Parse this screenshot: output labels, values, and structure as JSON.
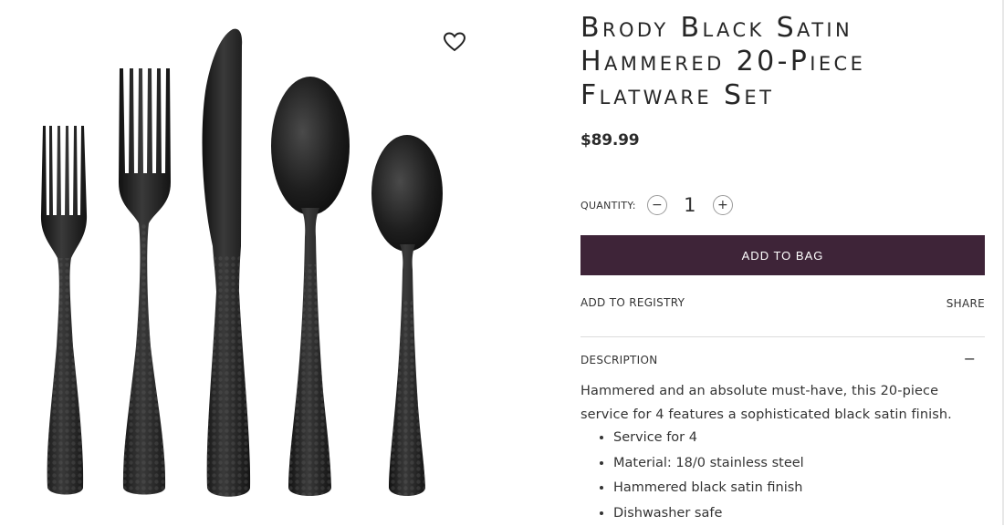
{
  "product": {
    "title_lines": [
      "Brody Black Satin",
      "Hammered 20-Piece",
      "Flatware Set"
    ],
    "price": "$89.99"
  },
  "quantity": {
    "label": "QUANTITY:",
    "value": "1",
    "minus": "−",
    "plus": "+"
  },
  "actions": {
    "add_to_bag": "ADD TO BAG",
    "add_to_registry": "ADD TO REGISTRY",
    "share": "SHARE"
  },
  "description": {
    "heading": "DESCRIPTION",
    "toggle": "−",
    "text": "Hammered and an absolute must-have, this 20-piece service for 4 features a sophisticated black satin finish.",
    "features": [
      "Service for 4",
      "Material: 18/0 stainless steel",
      "Hammered black satin finish",
      "Dishwasher safe"
    ]
  },
  "icons": {
    "wishlist": "heart-outline-icon"
  },
  "colors": {
    "button_bg": "#3e2438",
    "flatware": "#1e1e1e"
  }
}
